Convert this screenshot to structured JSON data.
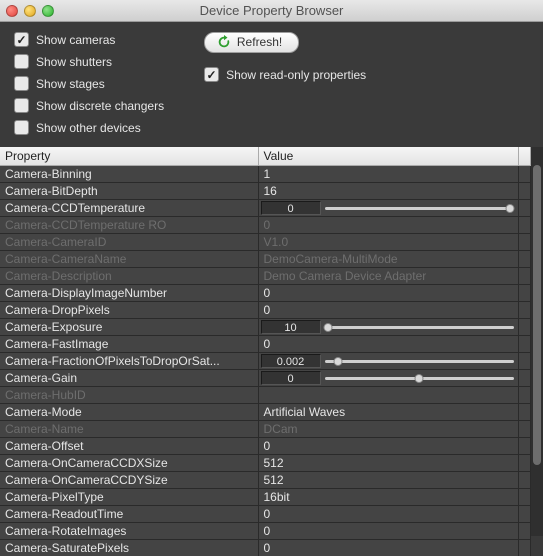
{
  "window": {
    "title": "Device Property Browser"
  },
  "filters": {
    "cameras": {
      "label": "Show cameras",
      "checked": true
    },
    "shutters": {
      "label": "Show shutters",
      "checked": false
    },
    "stages": {
      "label": "Show stages",
      "checked": false
    },
    "discrete": {
      "label": "Show discrete changers",
      "checked": false
    },
    "other": {
      "label": "Show other devices",
      "checked": false
    },
    "readonly": {
      "label": "Show read-only properties",
      "checked": true
    }
  },
  "buttons": {
    "refresh": "Refresh!"
  },
  "columns": {
    "property": "Property",
    "value": "Value"
  },
  "rows": [
    {
      "prop": "Camera-Binning",
      "value": "1",
      "readonly": false,
      "control": "plain"
    },
    {
      "prop": "Camera-BitDepth",
      "value": "16",
      "readonly": false,
      "control": "plain"
    },
    {
      "prop": "Camera-CCDTemperature",
      "value": "0",
      "readonly": false,
      "control": "slider",
      "thumb_pct": 97
    },
    {
      "prop": "Camera-CCDTemperature RO",
      "value": "0",
      "readonly": true,
      "control": "plain"
    },
    {
      "prop": "Camera-CameraID",
      "value": "V1.0",
      "readonly": true,
      "control": "plain"
    },
    {
      "prop": "Camera-CameraName",
      "value": "DemoCamera-MultiMode",
      "readonly": true,
      "control": "plain"
    },
    {
      "prop": "Camera-Description",
      "value": "Demo Camera Device Adapter",
      "readonly": true,
      "control": "plain"
    },
    {
      "prop": "Camera-DisplayImageNumber",
      "value": "0",
      "readonly": false,
      "control": "plain"
    },
    {
      "prop": "Camera-DropPixels",
      "value": "0",
      "readonly": false,
      "control": "plain"
    },
    {
      "prop": "Camera-Exposure",
      "value": "10",
      "readonly": false,
      "control": "slider",
      "thumb_pct": 3
    },
    {
      "prop": "Camera-FastImage",
      "value": "0",
      "readonly": false,
      "control": "plain"
    },
    {
      "prop": "Camera-FractionOfPixelsToDropOrSat...",
      "value": "0.002",
      "readonly": false,
      "control": "slider",
      "thumb_pct": 8
    },
    {
      "prop": "Camera-Gain",
      "value": "0",
      "readonly": false,
      "control": "slider",
      "thumb_pct": 50
    },
    {
      "prop": "Camera-HubID",
      "value": "",
      "readonly": true,
      "control": "plain"
    },
    {
      "prop": "Camera-Mode",
      "value": "Artificial Waves",
      "readonly": false,
      "control": "plain"
    },
    {
      "prop": "Camera-Name",
      "value": "DCam",
      "readonly": true,
      "control": "plain"
    },
    {
      "prop": "Camera-Offset",
      "value": "0",
      "readonly": false,
      "control": "plain"
    },
    {
      "prop": "Camera-OnCameraCCDXSize",
      "value": "512",
      "readonly": false,
      "control": "plain"
    },
    {
      "prop": "Camera-OnCameraCCDYSize",
      "value": "512",
      "readonly": false,
      "control": "plain"
    },
    {
      "prop": "Camera-PixelType",
      "value": "16bit",
      "readonly": false,
      "control": "plain"
    },
    {
      "prop": "Camera-ReadoutTime",
      "value": "0",
      "readonly": false,
      "control": "plain"
    },
    {
      "prop": "Camera-RotateImages",
      "value": "0",
      "readonly": false,
      "control": "plain"
    },
    {
      "prop": "Camera-SaturatePixels",
      "value": "0",
      "readonly": false,
      "control": "plain"
    }
  ]
}
